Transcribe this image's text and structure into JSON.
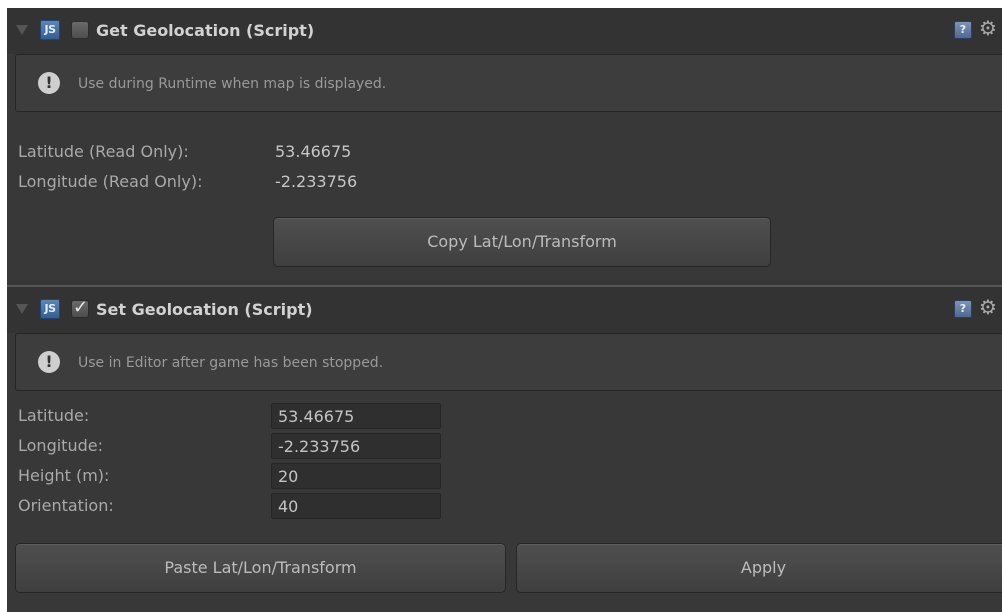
{
  "get_component": {
    "title": "Get Geolocation (Script)",
    "enabled": false,
    "script_icon": "JS",
    "help_icon": "?",
    "settings_icon": "⚙",
    "info_icon": "!",
    "help_text": "Use during Runtime when map is displayed.",
    "fields": [
      {
        "label": "Latitude (Read Only):",
        "value": "53.46675"
      },
      {
        "label": "Longitude (Read Only):",
        "value": "-2.233756"
      }
    ],
    "copy_button": "Copy Lat/Lon/Transform"
  },
  "set_component": {
    "title": "Set Geolocation (Script)",
    "enabled": true,
    "script_icon": "JS",
    "help_icon": "?",
    "settings_icon": "⚙",
    "info_icon": "!",
    "check_glyph": "✓",
    "help_text": "Use in Editor after game has been stopped.",
    "fields": [
      {
        "label": "Latitude:",
        "value": "53.46675"
      },
      {
        "label": "Longitude:",
        "value": "-2.233756"
      },
      {
        "label": "Height (m):",
        "value": "20"
      },
      {
        "label": "Orientation:",
        "value": "40"
      }
    ],
    "paste_button": "Paste Lat/Lon/Transform",
    "apply_button": "Apply"
  }
}
